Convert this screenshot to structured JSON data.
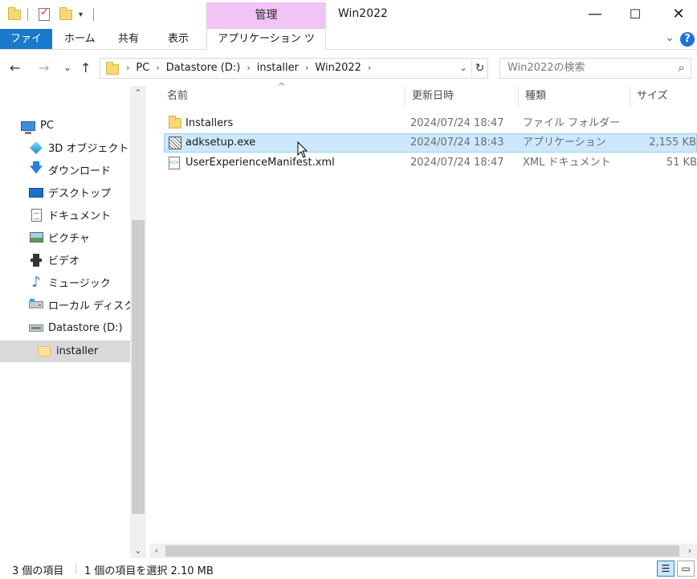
{
  "window": {
    "title": "Win2022",
    "context_tab": "管理",
    "minimize": "—",
    "maximize": "☐",
    "close": "✕"
  },
  "ribbon": {
    "tabs": [
      "ファイル",
      "ホーム",
      "共有",
      "表示",
      "アプリケーション ツール"
    ]
  },
  "navigation": {
    "back": "←",
    "forward": "→",
    "recent": "⌄",
    "up": "↑",
    "breadcrumbs": [
      "PC",
      "Datastore (D:)",
      "installer",
      "Win2022"
    ],
    "search_placeholder": "Win2022の検索"
  },
  "sidebar": {
    "items": [
      {
        "label": "PC",
        "icon": "pc-icon"
      },
      {
        "label": "3D オブジェクト",
        "icon": "3d-objects-icon"
      },
      {
        "label": "ダウンロード",
        "icon": "download-icon"
      },
      {
        "label": "デスクトップ",
        "icon": "desktop-icon"
      },
      {
        "label": "ドキュメント",
        "icon": "documents-icon"
      },
      {
        "label": "ピクチャ",
        "icon": "pictures-icon"
      },
      {
        "label": "ビデオ",
        "icon": "videos-icon"
      },
      {
        "label": "ミュージック",
        "icon": "music-icon"
      },
      {
        "label": "ローカル ディスク (C",
        "icon": "local-disk-icon"
      },
      {
        "label": "Datastore (D:)",
        "icon": "drive-icon"
      },
      {
        "label": "installer",
        "icon": "folder-icon",
        "selected": true
      }
    ]
  },
  "columns": {
    "name": "名前",
    "modified": "更新日時",
    "type": "種類",
    "size": "サイズ"
  },
  "files": [
    {
      "name": "Installers",
      "modified": "2024/07/24 18:47",
      "type": "ファイル フォルダー",
      "size": "",
      "icon": "folder-icon"
    },
    {
      "name": "adksetup.exe",
      "modified": "2024/07/24 18:43",
      "type": "アプリケーション",
      "size": "2,155 KB",
      "icon": "exe-icon",
      "selected": true
    },
    {
      "name": "UserExperienceManifest.xml",
      "modified": "2024/07/24 18:47",
      "type": "XML ドキュメント",
      "size": "51 KB",
      "icon": "xml-icon"
    }
  ],
  "status": {
    "item_count": "3 個の項目",
    "selection": "1 個の項目を選択  2.10 MB"
  }
}
